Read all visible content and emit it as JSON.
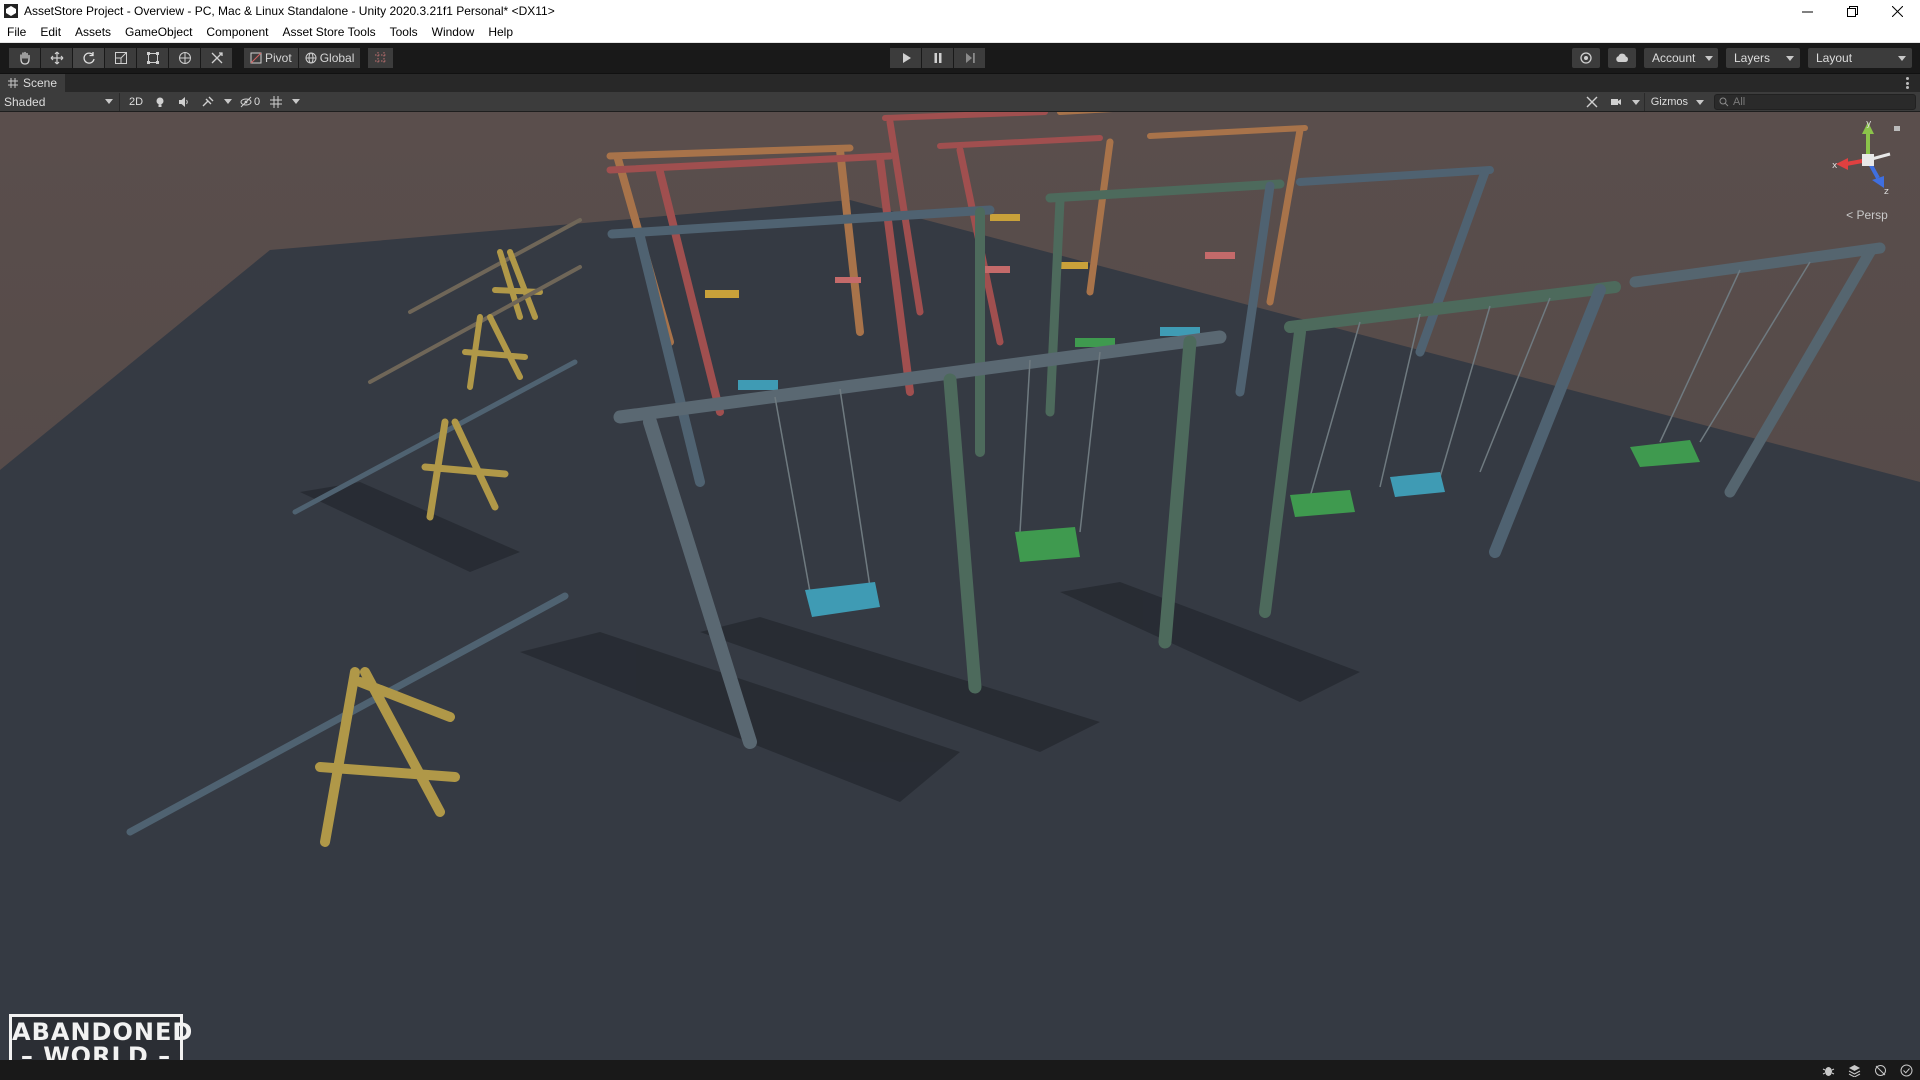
{
  "window": {
    "title": "AssetStore Project - Overview - PC, Mac & Linux Standalone - Unity 2020.3.21f1 Personal* <DX11>"
  },
  "menu": [
    "File",
    "Edit",
    "Assets",
    "GameObject",
    "Component",
    "Asset Store Tools",
    "Tools",
    "Window",
    "Help"
  ],
  "toolbar": {
    "pivot_label": "Pivot",
    "global_label": "Global",
    "account_label": "Account",
    "layers_label": "Layers",
    "layout_label": "Layout"
  },
  "scene_tab": {
    "label": "Scene"
  },
  "scene_bar": {
    "shading_mode": "Shaded",
    "toggle_2d": "2D",
    "hidden_count": "0",
    "gizmos_label": "Gizmos",
    "search_placeholder": "All"
  },
  "gizmo": {
    "projection": "< Persp",
    "axis_x": "x",
    "axis_y": "y",
    "axis_z": "z"
  },
  "logo": {
    "line1": "ABANDONED",
    "line2": "WORLD"
  },
  "colors": {
    "ground": "#353a43",
    "background": "#5a4e4c",
    "frame_blue": "#4f6271",
    "frame_green": "#4d6a5c",
    "frame_red": "#a04f4f",
    "frame_orange": "#a8734a",
    "seat_blue": "#3f9bb4",
    "seat_green": "#3f9a4f",
    "seat_yellow": "#c9a13a",
    "seesaw_wood": "#b09848"
  }
}
